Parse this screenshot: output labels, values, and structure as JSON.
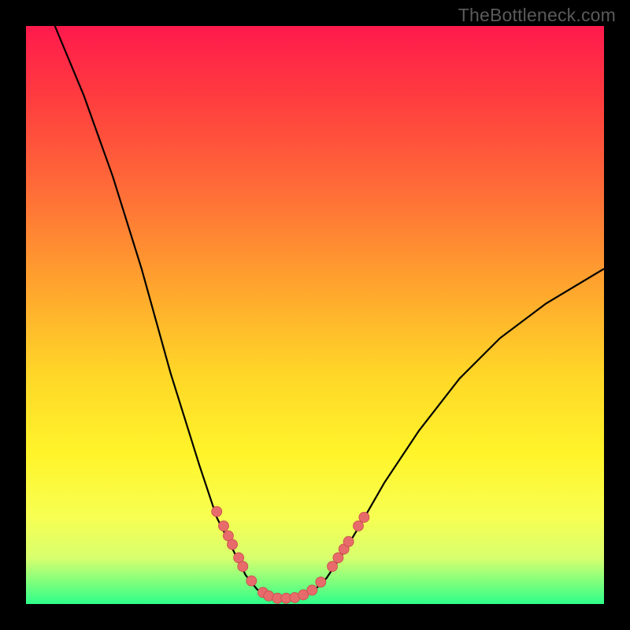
{
  "watermark": "TheBottleneck.com",
  "colors": {
    "background": "#000000",
    "gradient_top": "#ff1a4d",
    "gradient_bottom": "#2eff8a",
    "curve_stroke": "#000000",
    "marker_fill": "#e86b6b",
    "marker_stroke": "#c94a4a"
  },
  "chart_data": {
    "type": "line",
    "title": "",
    "xlabel": "",
    "ylabel": "",
    "xlim": [
      0,
      100
    ],
    "ylim": [
      0,
      100
    ],
    "grid": false,
    "legend": false,
    "series": [
      {
        "name": "bottleneck-curve",
        "x": [
          5,
          10,
          15,
          20,
          25,
          30,
          33,
          36,
          38,
          40,
          42,
          44,
          46,
          48,
          50,
          52,
          55,
          58,
          62,
          68,
          75,
          82,
          90,
          100
        ],
        "y": [
          100,
          88,
          74,
          58,
          40,
          24,
          15,
          9,
          5,
          2.5,
          1.5,
          1,
          1,
          1.5,
          2.5,
          4.5,
          9,
          14,
          21,
          30,
          39,
          46,
          52,
          58
        ]
      }
    ],
    "markers": [
      {
        "x": 33.0,
        "y": 16.0
      },
      {
        "x": 34.2,
        "y": 13.5
      },
      {
        "x": 35.0,
        "y": 11.8
      },
      {
        "x": 35.7,
        "y": 10.3
      },
      {
        "x": 36.8,
        "y": 8.0
      },
      {
        "x": 37.5,
        "y": 6.5
      },
      {
        "x": 39.0,
        "y": 4.0
      },
      {
        "x": 41.0,
        "y": 2.0
      },
      {
        "x": 42.0,
        "y": 1.4
      },
      {
        "x": 43.5,
        "y": 1.0
      },
      {
        "x": 45.0,
        "y": 1.0
      },
      {
        "x": 46.5,
        "y": 1.1
      },
      {
        "x": 48.0,
        "y": 1.6
      },
      {
        "x": 49.5,
        "y": 2.4
      },
      {
        "x": 51.0,
        "y": 3.8
      },
      {
        "x": 53.0,
        "y": 6.5
      },
      {
        "x": 54.0,
        "y": 8.0
      },
      {
        "x": 55.0,
        "y": 9.5
      },
      {
        "x": 55.8,
        "y": 10.8
      },
      {
        "x": 57.5,
        "y": 13.5
      },
      {
        "x": 58.5,
        "y": 15.0
      }
    ]
  }
}
